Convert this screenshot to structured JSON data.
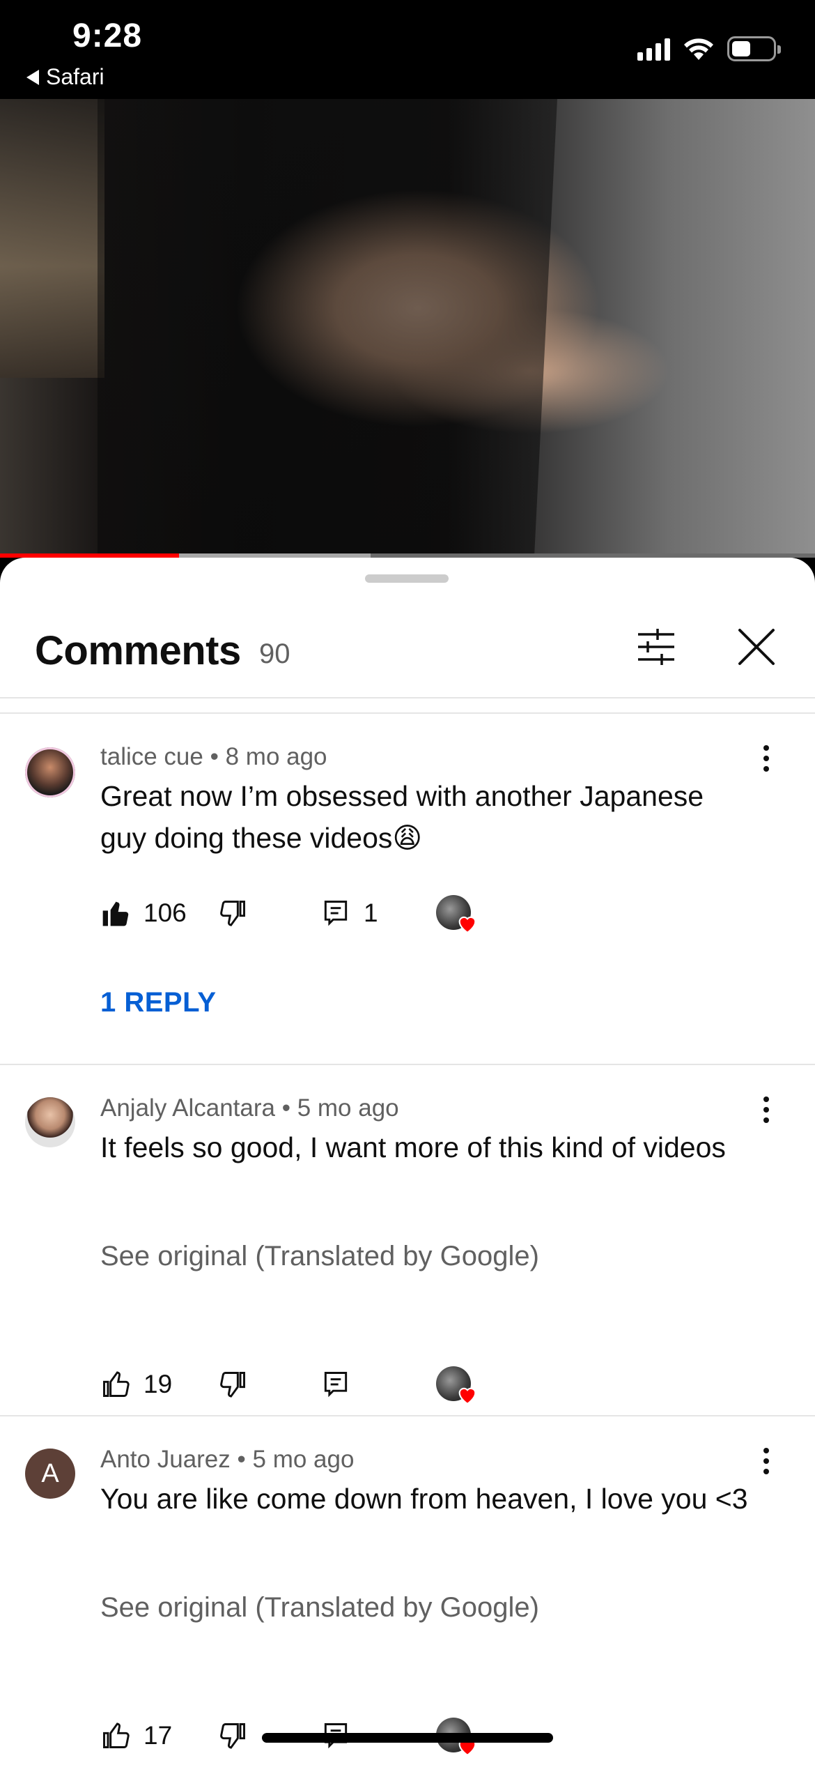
{
  "status_bar": {
    "time": "9:28",
    "back_app": "Safari",
    "battery_level": 0.45
  },
  "video": {
    "progress_played": 0.22,
    "progress_buffered": 0.455
  },
  "sheet": {
    "title": "Comments",
    "count": "90",
    "icons": [
      "filter-icon",
      "close-icon"
    ]
  },
  "comments": [
    {
      "author": "talice cue",
      "age": "8 mo ago",
      "text": "Great now I’m obsessed with another Japanese guy doing these videos😩",
      "likes": "106",
      "replies_count": "1",
      "liked": true,
      "reply_link": "1 REPLY"
    },
    {
      "author": "Anjaly Alcantara",
      "age": "5 mo ago",
      "text": "It feels so good, I want more of this kind of videos",
      "translated_note": "See original (Translated by Google)",
      "likes": "19",
      "liked": false
    },
    {
      "author": "Anto Juarez",
      "avatar_letter": "A",
      "age": "5 mo ago",
      "text": "You are like come down from heaven, I love you <3",
      "translated_note": "See original (Translated by Google)",
      "likes": "17",
      "liked": false
    }
  ],
  "colors": {
    "accent_link": "#065fd4",
    "progress_red": "#ff0000",
    "heart": "#ff0000",
    "avatar_letter_bg": "#5d4037"
  }
}
